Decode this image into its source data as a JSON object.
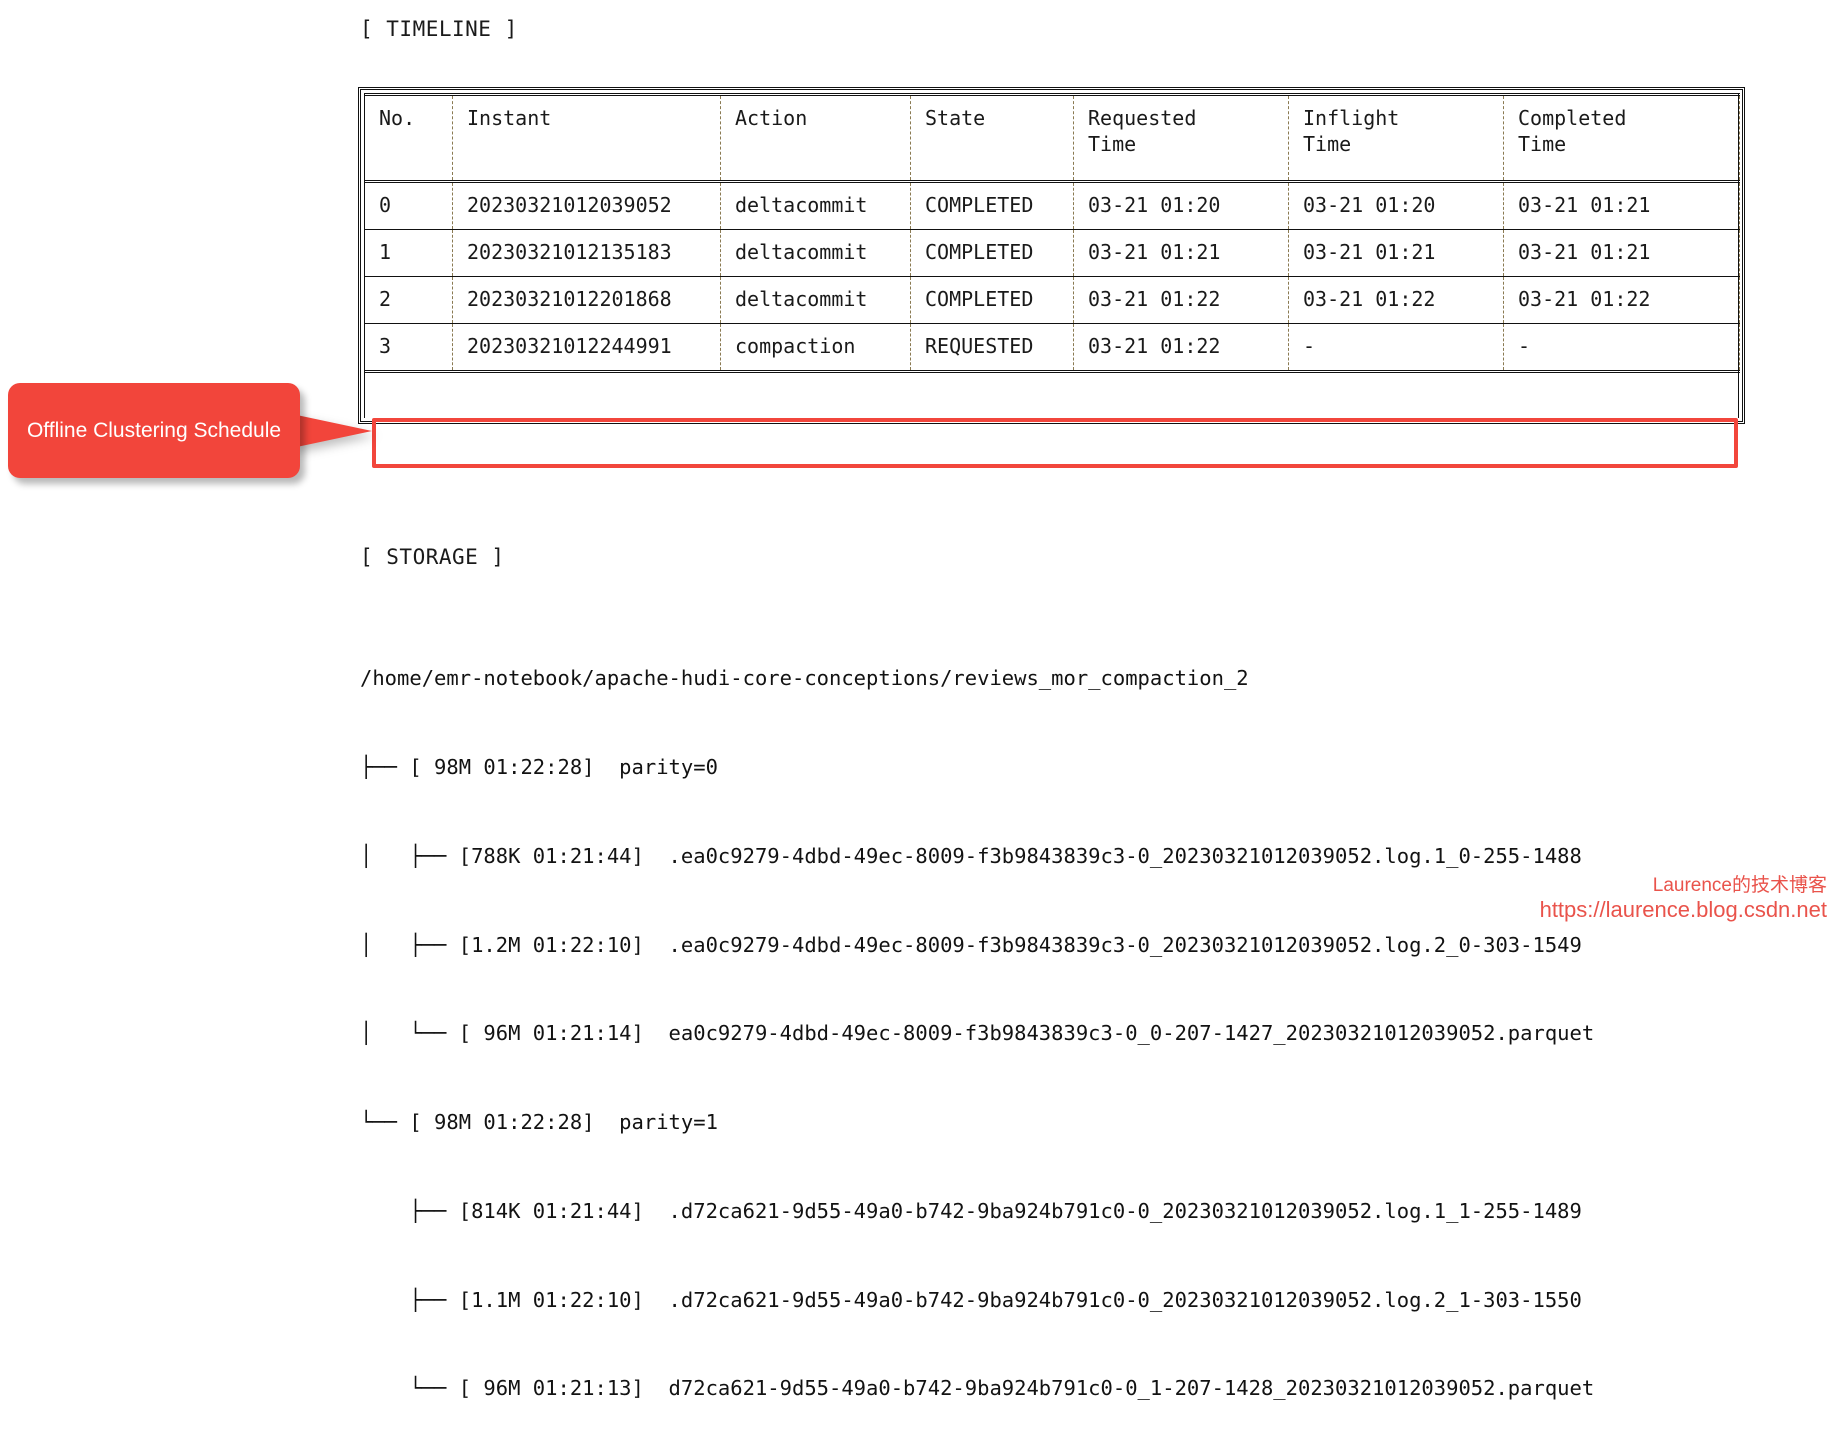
{
  "sections": {
    "timeline_label": "[ TIMELINE ]",
    "storage_label": "[ STORAGE ]"
  },
  "timeline_table": {
    "columns": [
      "No.",
      "Instant",
      "Action",
      "State",
      "Requested\nTime",
      "Inflight\nTime",
      "Completed\nTime"
    ],
    "rows": [
      {
        "no": "0",
        "instant": "20230321012039052",
        "action": "deltacommit",
        "state": "COMPLETED",
        "requested_time": "03-21 01:20",
        "inflight_time": "03-21 01:20",
        "completed_time": "03-21 01:21",
        "highlighted": false
      },
      {
        "no": "1",
        "instant": "20230321012135183",
        "action": "deltacommit",
        "state": "COMPLETED",
        "requested_time": "03-21 01:21",
        "inflight_time": "03-21 01:21",
        "completed_time": "03-21 01:21",
        "highlighted": false
      },
      {
        "no": "2",
        "instant": "20230321012201868",
        "action": "deltacommit",
        "state": "COMPLETED",
        "requested_time": "03-21 01:22",
        "inflight_time": "03-21 01:22",
        "completed_time": "03-21 01:22",
        "highlighted": false
      },
      {
        "no": "3",
        "instant": "20230321012244991",
        "action": "compaction",
        "state": "REQUESTED",
        "requested_time": "03-21 01:22",
        "inflight_time": "-",
        "completed_time": "-",
        "highlighted": true
      }
    ]
  },
  "callout": {
    "text": "Offline Clustering Schedule",
    "color": "#f2453b"
  },
  "storage": {
    "root_path": "/home/emr-notebook/apache-hudi-core-conceptions/reviews_mor_compaction_2",
    "lines": [
      "├── [ 98M 01:22:28]  parity=0",
      "│   ├── [788K 01:21:44]  .ea0c9279-4dbd-49ec-8009-f3b9843839c3-0_20230321012039052.log.1_0-255-1488",
      "│   ├── [1.2M 01:22:10]  .ea0c9279-4dbd-49ec-8009-f3b9843839c3-0_20230321012039052.log.2_0-303-1549",
      "│   └── [ 96M 01:21:14]  ea0c9279-4dbd-49ec-8009-f3b9843839c3-0_0-207-1427_20230321012039052.parquet",
      "└── [ 98M 01:22:28]  parity=1",
      "    ├── [814K 01:21:44]  .d72ca621-9d55-49a0-b742-9ba924b791c0-0_20230321012039052.log.1_1-255-1489",
      "    ├── [1.1M 01:22:10]  .d72ca621-9d55-49a0-b742-9ba924b791c0-0_20230321012039052.log.2_1-303-1550",
      "    └── [ 96M 01:21:13]  d72ca621-9d55-49a0-b742-9ba924b791c0-0_1-207-1428_20230321012039052.parquet"
    ]
  },
  "watermark": {
    "title": "Laurence的技术博客",
    "url": "https://laurence.blog.csdn.net",
    "color": "#e8453c"
  }
}
